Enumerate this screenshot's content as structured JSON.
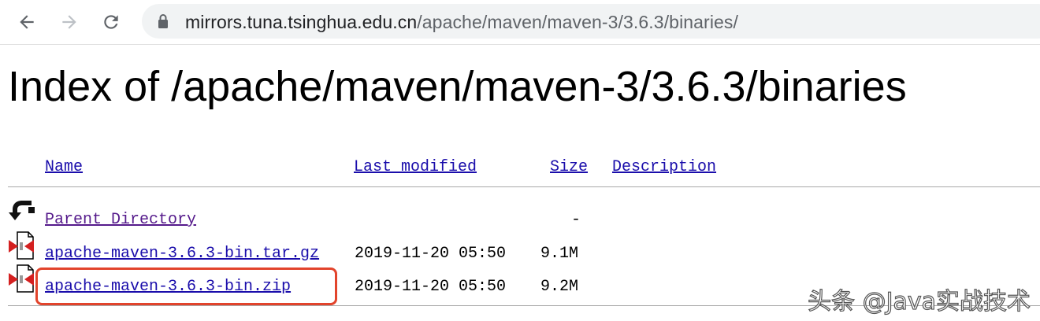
{
  "browser": {
    "url_host": "mirrors.tuna.tsinghua.edu.cn",
    "url_path": "/apache/maven/maven-3/3.6.3/binaries/",
    "back_icon": "arrow-left-icon",
    "forward_icon": "arrow-right-icon",
    "reload_icon": "reload-icon",
    "lock_icon": "lock-icon"
  },
  "page": {
    "title": "Index of /apache/maven/maven-3/3.6.3/binaries"
  },
  "table": {
    "headers": {
      "name": "Name",
      "last_modified": "Last modified",
      "size": "Size",
      "description": "Description"
    },
    "parent": {
      "name": "Parent Directory",
      "size": "-",
      "icon": "back-folder-icon"
    },
    "rows": [
      {
        "name": "apache-maven-3.6.3-bin.tar.gz",
        "last_modified": "2019-11-20 05:50",
        "size": "9.1M",
        "icon": "compressed-file-icon"
      },
      {
        "name": "apache-maven-3.6.3-bin.zip",
        "last_modified": "2019-11-20 05:50",
        "size": "9.2M",
        "icon": "compressed-file-icon"
      }
    ]
  },
  "annotation": {
    "highlight_color": "#e2442c"
  },
  "watermark": {
    "text": "头条 @Java实战技术"
  },
  "colors": {
    "link": "#1a0dab",
    "visited_link": "#551a8b",
    "omnibox_bg": "#f1f3f4"
  }
}
